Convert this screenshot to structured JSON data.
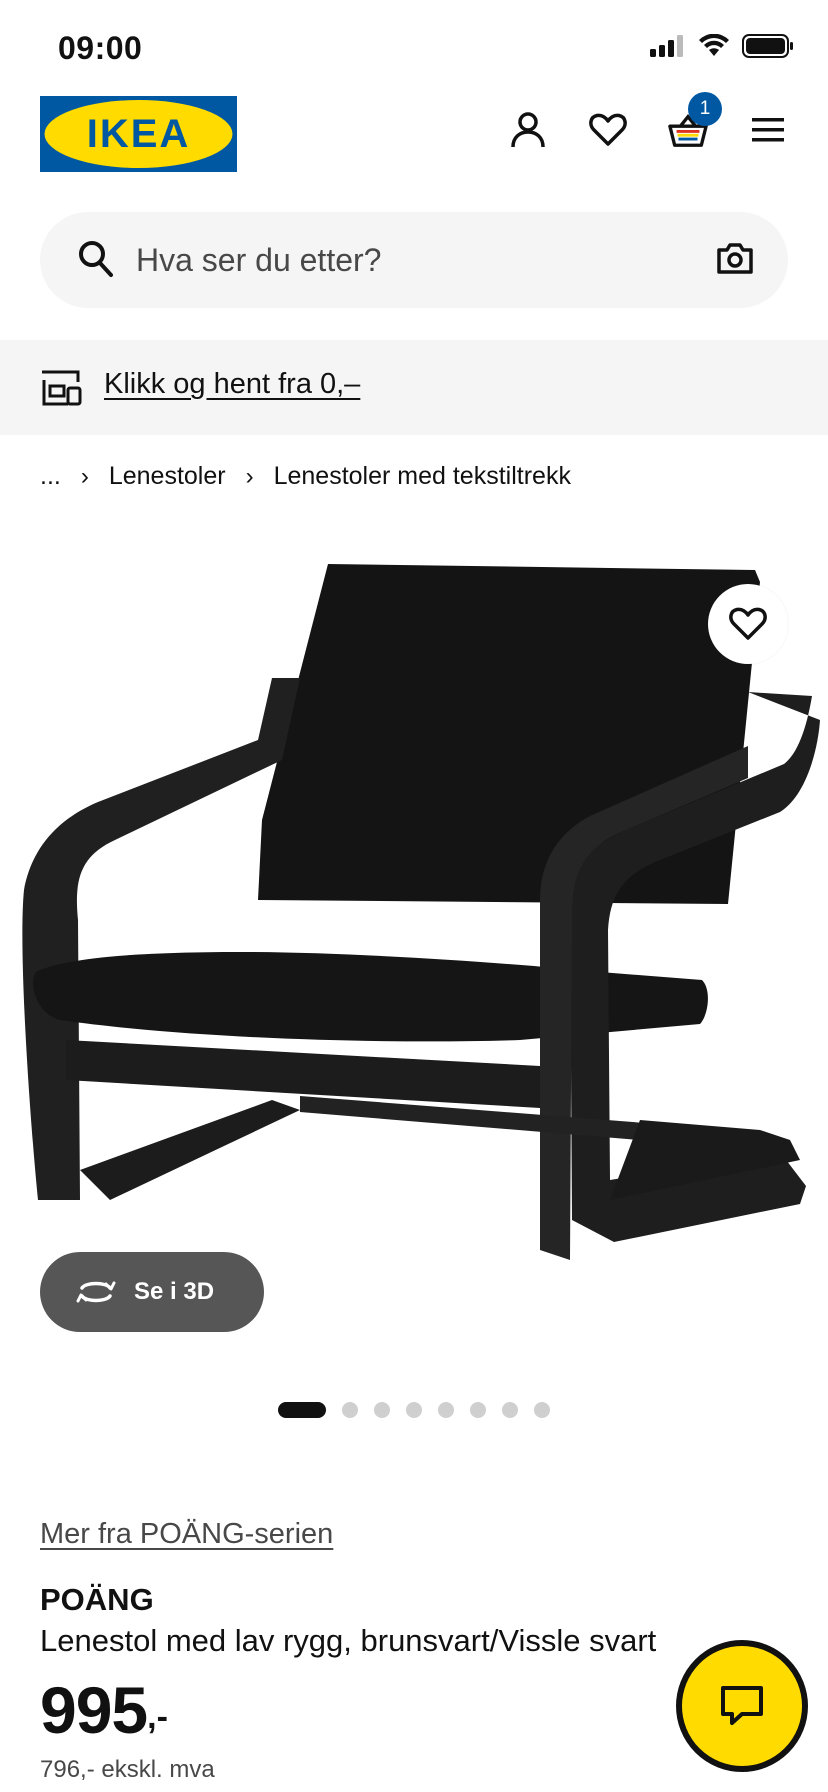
{
  "status_bar": {
    "time": "09:00"
  },
  "header": {
    "logo_text": "IKEA",
    "cart_count": "1",
    "icons": [
      "user-icon",
      "heart-icon",
      "cart-icon",
      "menu-icon"
    ]
  },
  "search": {
    "placeholder": "Hva ser du etter?"
  },
  "promo": {
    "label": "Klikk og hent fra 0,–"
  },
  "breadcrumb": {
    "ellipsis": "...",
    "items": [
      "Lenestoler",
      "Lenestoler med tekstiltrekk"
    ]
  },
  "product": {
    "view_3d_label": "Se i 3D",
    "gallery_count": 8,
    "gallery_active_index": 0,
    "series_link": "Mer fra POÄNG-serien",
    "name": "POÄNG",
    "description": "Lenestol med lav rygg, brunsvart/Vissle svart",
    "price": "995",
    "price_suffix": ",-",
    "price_ex_vat": "796,- ekskl. mva"
  },
  "colors": {
    "brand_blue": "#0058a3",
    "brand_yellow": "#ffdb00",
    "text": "#111111",
    "muted": "#484848"
  }
}
